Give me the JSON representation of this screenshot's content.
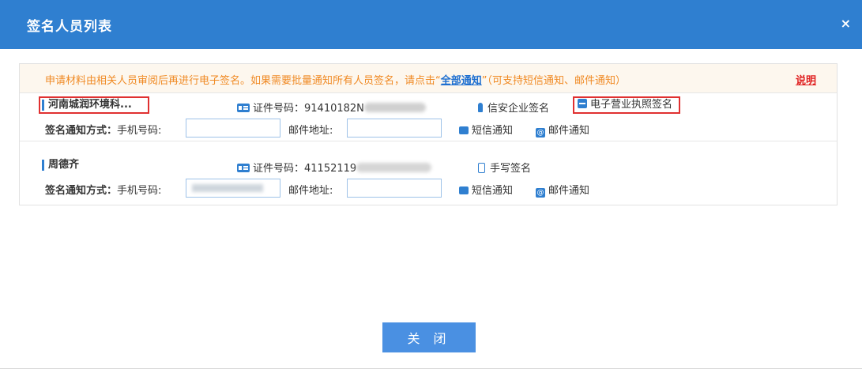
{
  "dialog": {
    "title": "签名人员列表",
    "close_icon": "×"
  },
  "notice": {
    "text_before": "申请材料由相关人员审阅后再进行电子签名。如果需要批量通知所有人员签名，请点击“",
    "link": "全部通知",
    "text_after": "”（可支持短信通知、邮件通知）",
    "help": "说明"
  },
  "persons": [
    {
      "name": "河南城润环境科...",
      "cert_label": "证件号码：",
      "cert_visible": "91410182N",
      "sign_type": "信安企业签名",
      "extra_sign": "电子营业执照签名",
      "notify_label": "签名通知方式：",
      "phone_label": "手机号码:",
      "phone_value": "",
      "email_label": "邮件地址:",
      "email_value": "",
      "sms": "短信通知",
      "email_notify": "邮件通知"
    },
    {
      "name": "周德齐",
      "cert_label": "证件号码：",
      "cert_visible": "41152119",
      "sign_type": "手写签名",
      "notify_label": "签名通知方式：",
      "phone_label": "手机号码:",
      "phone_value": "",
      "email_label": "邮件地址:",
      "email_value": "",
      "sms": "短信通知",
      "email_notify": "邮件通知"
    }
  ],
  "footer": {
    "close_button": "关 闭"
  },
  "colors": {
    "title_bar": "#2f7fd0",
    "notice_text": "#f08a24",
    "highlight_box": "#e03030",
    "button": "#4a90e2"
  }
}
